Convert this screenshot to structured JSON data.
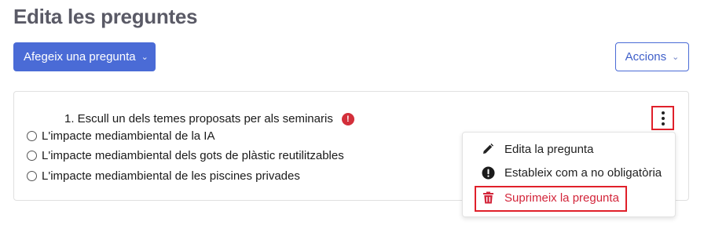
{
  "page": {
    "title": "Edita les preguntes"
  },
  "toolbar": {
    "add_question_label": "Afegeix una pregunta",
    "actions_label": "Accions"
  },
  "question": {
    "text": "1. Escull un dels temes proposats per als seminaris",
    "options": [
      "L'impacte mediambiental de la IA",
      "L'impacte mediambiental dels gots de plàstic reutilitzables",
      "L'impacte mediambiental de les piscines privades"
    ]
  },
  "menu": {
    "items": [
      {
        "label": "Edita la pregunta",
        "icon": "pencil-icon"
      },
      {
        "label": "Estableix com a no obligatòria",
        "icon": "exclamation-circle-icon"
      },
      {
        "label": "Suprimeix la pregunta",
        "icon": "trash-icon"
      }
    ]
  },
  "colors": {
    "primary": "#4a6bd6",
    "danger": "#d3253a",
    "highlight": "#e0202a"
  }
}
